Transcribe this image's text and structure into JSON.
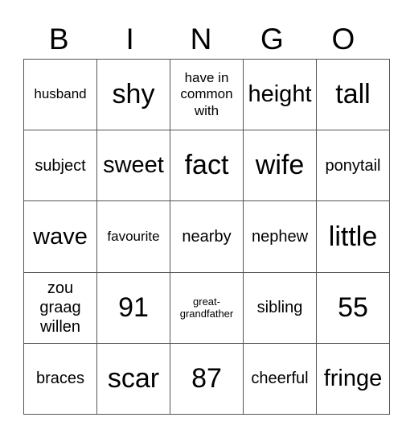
{
  "header": [
    "B",
    "I",
    "N",
    "G",
    "O"
  ],
  "rows": [
    [
      {
        "text": "husband",
        "size": "s-s"
      },
      {
        "text": "shy",
        "size": "s-xl"
      },
      {
        "text": "have in common with",
        "size": "s-s"
      },
      {
        "text": "height",
        "size": "s-l"
      },
      {
        "text": "tall",
        "size": "s-xl"
      }
    ],
    [
      {
        "text": "subject",
        "size": "s-m"
      },
      {
        "text": "sweet",
        "size": "s-l"
      },
      {
        "text": "fact",
        "size": "s-xl"
      },
      {
        "text": "wife",
        "size": "s-xl"
      },
      {
        "text": "ponytail",
        "size": "s-m"
      }
    ],
    [
      {
        "text": "wave",
        "size": "s-l"
      },
      {
        "text": "favourite",
        "size": "s-s"
      },
      {
        "text": "nearby",
        "size": "s-m"
      },
      {
        "text": "nephew",
        "size": "s-m"
      },
      {
        "text": "little",
        "size": "s-xl"
      }
    ],
    [
      {
        "text": "zou graag willen",
        "size": "s-m"
      },
      {
        "text": "91",
        "size": "s-xl"
      },
      {
        "text": "great-grandfather",
        "size": "s-xs"
      },
      {
        "text": "sibling",
        "size": "s-m"
      },
      {
        "text": "55",
        "size": "s-xl"
      }
    ],
    [
      {
        "text": "braces",
        "size": "s-m"
      },
      {
        "text": "scar",
        "size": "s-xl"
      },
      {
        "text": "87",
        "size": "s-xl"
      },
      {
        "text": "cheerful",
        "size": "s-m"
      },
      {
        "text": "fringe",
        "size": "s-l"
      }
    ]
  ]
}
